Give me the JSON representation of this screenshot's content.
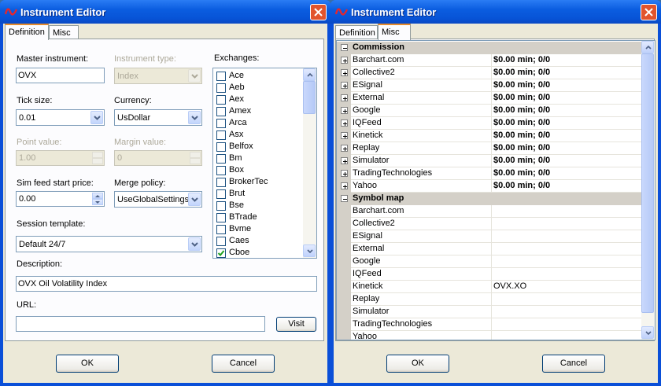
{
  "left_window": {
    "title": "Instrument Editor",
    "tabs": [
      "Definition",
      "Misc"
    ],
    "active_tab": "Definition",
    "master_instrument": {
      "label": "Master instrument:",
      "value": "OVX"
    },
    "instrument_type": {
      "label": "Instrument type:",
      "value": "Index"
    },
    "exchanges": {
      "label": "Exchanges:",
      "items": [
        {
          "name": "Ace",
          "checked": false
        },
        {
          "name": "Aeb",
          "checked": false
        },
        {
          "name": "Aex",
          "checked": false
        },
        {
          "name": "Amex",
          "checked": false
        },
        {
          "name": "Arca",
          "checked": false
        },
        {
          "name": "Asx",
          "checked": false
        },
        {
          "name": "Belfox",
          "checked": false
        },
        {
          "name": "Bm",
          "checked": false
        },
        {
          "name": "Box",
          "checked": false
        },
        {
          "name": "BrokerTec",
          "checked": false
        },
        {
          "name": "Brut",
          "checked": false
        },
        {
          "name": "Bse",
          "checked": false
        },
        {
          "name": "BTrade",
          "checked": false
        },
        {
          "name": "Bvme",
          "checked": false
        },
        {
          "name": "Caes",
          "checked": false
        },
        {
          "name": "Cboe",
          "checked": true
        }
      ]
    },
    "tick_size": {
      "label": "Tick size:",
      "value": "0.01"
    },
    "currency": {
      "label": "Currency:",
      "value": "UsDollar"
    },
    "point_value": {
      "label": "Point value:",
      "value": "1.00"
    },
    "margin_value": {
      "label": "Margin value:",
      "value": "0"
    },
    "sim_feed_start_price": {
      "label": "Sim feed start price:",
      "value": "0.00"
    },
    "merge_policy": {
      "label": "Merge policy:",
      "value": "UseGlobalSettings"
    },
    "session_template": {
      "label": "Session template:",
      "value": "Default 24/7"
    },
    "description": {
      "label": "Description:",
      "value": "OVX Oil Volatility Index"
    },
    "url": {
      "label": "URL:",
      "value": ""
    },
    "visit_button": "Visit",
    "ok_button": "OK",
    "cancel_button": "Cancel"
  },
  "right_window": {
    "title": "Instrument Editor",
    "tabs": [
      "Definition",
      "Misc"
    ],
    "active_tab": "Misc",
    "commission": {
      "label": "Commission",
      "rows": [
        {
          "name": "Barchart.com",
          "value": "$0.00 min;  0/0"
        },
        {
          "name": "Collective2",
          "value": "$0.00 min;  0/0"
        },
        {
          "name": "ESignal",
          "value": "$0.00 min;  0/0"
        },
        {
          "name": "External",
          "value": "$0.00 min;  0/0"
        },
        {
          "name": "Google",
          "value": "$0.00 min;  0/0"
        },
        {
          "name": "IQFeed",
          "value": "$0.00 min;  0/0"
        },
        {
          "name": "Kinetick",
          "value": "$0.00 min;  0/0"
        },
        {
          "name": "Replay",
          "value": "$0.00 min;  0/0"
        },
        {
          "name": "Simulator",
          "value": "$0.00 min;  0/0"
        },
        {
          "name": "TradingTechnologies",
          "value": "$0.00 min;  0/0"
        },
        {
          "name": "Yahoo",
          "value": "$0.00 min;  0/0"
        }
      ]
    },
    "symbol_map": {
      "label": "Symbol map",
      "rows": [
        {
          "name": "Barchart.com",
          "value": ""
        },
        {
          "name": "Collective2",
          "value": ""
        },
        {
          "name": "ESignal",
          "value": ""
        },
        {
          "name": "External",
          "value": ""
        },
        {
          "name": "Google",
          "value": ""
        },
        {
          "name": "IQFeed",
          "value": ""
        },
        {
          "name": "Kinetick",
          "value": "OVX.XO"
        },
        {
          "name": "Replay",
          "value": ""
        },
        {
          "name": "Simulator",
          "value": ""
        },
        {
          "name": "TradingTechnologies",
          "value": ""
        },
        {
          "name": "Yahoo",
          "value": ""
        }
      ]
    },
    "ok_button": "OK",
    "cancel_button": "Cancel"
  },
  "colors": {
    "titlebar": "#0753d6",
    "dialog": "#ece9d8",
    "close": "#e2542d"
  },
  "icons": {
    "app": "ninja-logo-icon",
    "close": "close-icon"
  }
}
